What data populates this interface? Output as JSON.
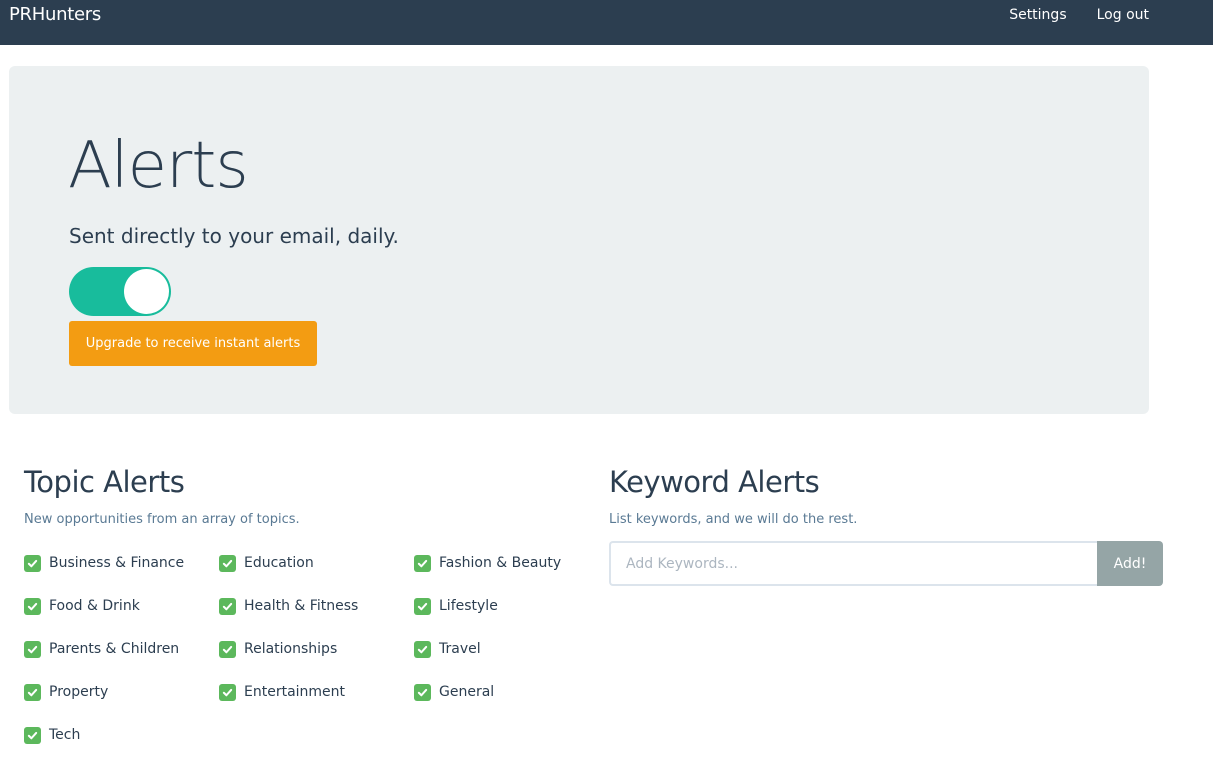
{
  "navbar": {
    "brand": "PRHunters",
    "links": [
      "Settings",
      "Log out"
    ]
  },
  "hero": {
    "title": "Alerts",
    "subtitle": "Sent directly to your email, daily.",
    "toggle_on": true,
    "upgrade_button": "Upgrade to receive instant alerts"
  },
  "topics": {
    "title": "Topic Alerts",
    "subtitle": "New opportunities from an array of topics.",
    "items": [
      {
        "label": "Business & Finance",
        "checked": true
      },
      {
        "label": "Education",
        "checked": true
      },
      {
        "label": "Fashion & Beauty",
        "checked": true
      },
      {
        "label": "Food & Drink",
        "checked": true
      },
      {
        "label": "Health & Fitness",
        "checked": true
      },
      {
        "label": "Lifestyle",
        "checked": true
      },
      {
        "label": "Parents & Children",
        "checked": true
      },
      {
        "label": "Relationships",
        "checked": true
      },
      {
        "label": "Travel",
        "checked": true
      },
      {
        "label": "Property",
        "checked": true
      },
      {
        "label": "Entertainment",
        "checked": true
      },
      {
        "label": "General",
        "checked": true
      },
      {
        "label": "Tech",
        "checked": true
      }
    ]
  },
  "keywords": {
    "title": "Keyword Alerts",
    "subtitle": "List keywords, and we will do the rest.",
    "input_value": "",
    "input_placeholder": "Add Keywords...",
    "add_button": "Add!"
  },
  "colors": {
    "navbar": "#2c3e50",
    "toggle": "#18bc9c",
    "upgrade": "#f39c12",
    "checkbox": "#5cb85c",
    "add_button": "#95a5a6"
  }
}
